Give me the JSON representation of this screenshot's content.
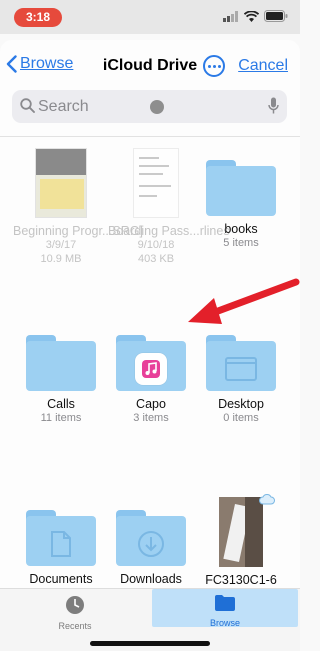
{
  "status": {
    "time": "3:18"
  },
  "nav": {
    "back_label": "Browse",
    "title": "iCloud Drive",
    "cancel_label": "Cancel"
  },
  "search": {
    "placeholder": "Search"
  },
  "items": [
    {
      "name": "Beginning Progr...SRG]",
      "line1": "3/9/17",
      "line2": "10.9 MB",
      "kind": "book-thumbnail",
      "dimmed": true
    },
    {
      "name": "Boarding Pass...rlines",
      "line1": "9/10/18",
      "line2": "403 KB",
      "kind": "document-thumbnail",
      "dimmed": true
    },
    {
      "name": "books",
      "line1": "5 items",
      "kind": "folder"
    },
    {
      "name": "Calls",
      "line1": "11 items",
      "kind": "folder"
    },
    {
      "name": "Capo",
      "line1": "3 items",
      "kind": "app-folder"
    },
    {
      "name": "Desktop",
      "line1": "0 items",
      "kind": "desktop-folder"
    },
    {
      "name": "Documents",
      "kind": "documents-folder"
    },
    {
      "name": "Downloads",
      "kind": "downloads-folder"
    },
    {
      "name": "FC3130C1-6",
      "kind": "photo-thumbnail"
    }
  ],
  "tabbar": {
    "recents_label": "Recents",
    "browse_label": "Browse",
    "selected": "Browse"
  },
  "colors": {
    "accent": "#2b7ae6",
    "folder": "#9dd0f2",
    "status_pill": "#e64a3c",
    "annotation_arrow": "#e3202a",
    "selected_tab": "#bfe0f9"
  },
  "annotation": {
    "type": "arrow",
    "icon": "red-arrow"
  }
}
